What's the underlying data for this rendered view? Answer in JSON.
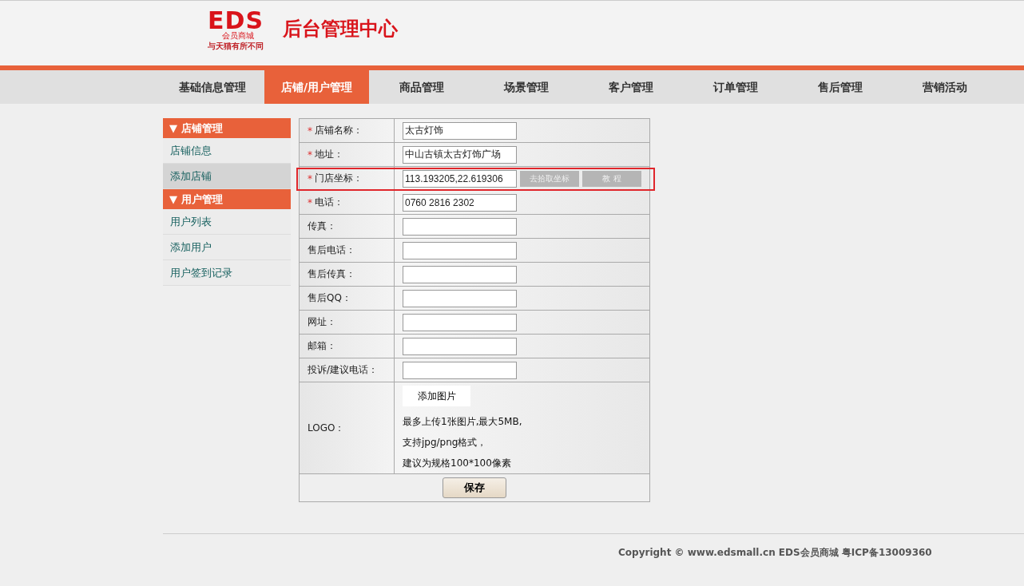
{
  "header": {
    "logo_mark": "EDS",
    "logo_sub": "会员商城",
    "logo_slogan": "与天猫有所不同",
    "title": "后台管理中心"
  },
  "nav": [
    {
      "label": "基础信息管理",
      "selected": false
    },
    {
      "label": "店铺/用户管理",
      "selected": true
    },
    {
      "label": "商品管理",
      "selected": false
    },
    {
      "label": "场景管理",
      "selected": false
    },
    {
      "label": "客户管理",
      "selected": false
    },
    {
      "label": "订单管理",
      "selected": false
    },
    {
      "label": "售后管理",
      "selected": false
    },
    {
      "label": "营销活动",
      "selected": false
    }
  ],
  "sidebar": [
    {
      "title": "▼ 店铺管理",
      "items": [
        {
          "label": "店铺信息",
          "selected": false
        },
        {
          "label": "添加店铺",
          "selected": true
        }
      ]
    },
    {
      "title": "▼ 用户管理",
      "items": [
        {
          "label": "用户列表",
          "selected": false
        },
        {
          "label": "添加用户",
          "selected": false
        },
        {
          "label": "用户签到记录",
          "selected": false
        }
      ]
    }
  ],
  "form": {
    "rows": [
      {
        "marker": "*",
        "label": "店铺名称：",
        "value": "太古灯饰"
      },
      {
        "marker": "*",
        "label": "地址：",
        "value": "中山古镇太古灯饰广场"
      },
      {
        "marker": "*",
        "label": "门店坐标：",
        "value": "113.193205,22.619306",
        "highlighted": true,
        "buttons": [
          "去拾取坐标",
          "教 程"
        ]
      },
      {
        "marker": "*",
        "label": "电话：",
        "value": "0760 2816 2302"
      },
      {
        "label": "传真："
      },
      {
        "label": "售后电话："
      },
      {
        "label": "售后传真："
      },
      {
        "label": "售后QQ："
      },
      {
        "label": "网址："
      },
      {
        "label": "邮箱："
      },
      {
        "label": "投诉/建议电话："
      }
    ],
    "logo": {
      "label": "LOGO：",
      "button": "添加图片",
      "notes": [
        "最多上传1张图片,最大5MB,",
        "支持jpg/png格式，",
        "建议为规格100*100像素"
      ]
    },
    "save": "保存"
  },
  "footer": "Copyright © www.edsmall.cn EDS会员商城 粤ICP备13009360"
}
